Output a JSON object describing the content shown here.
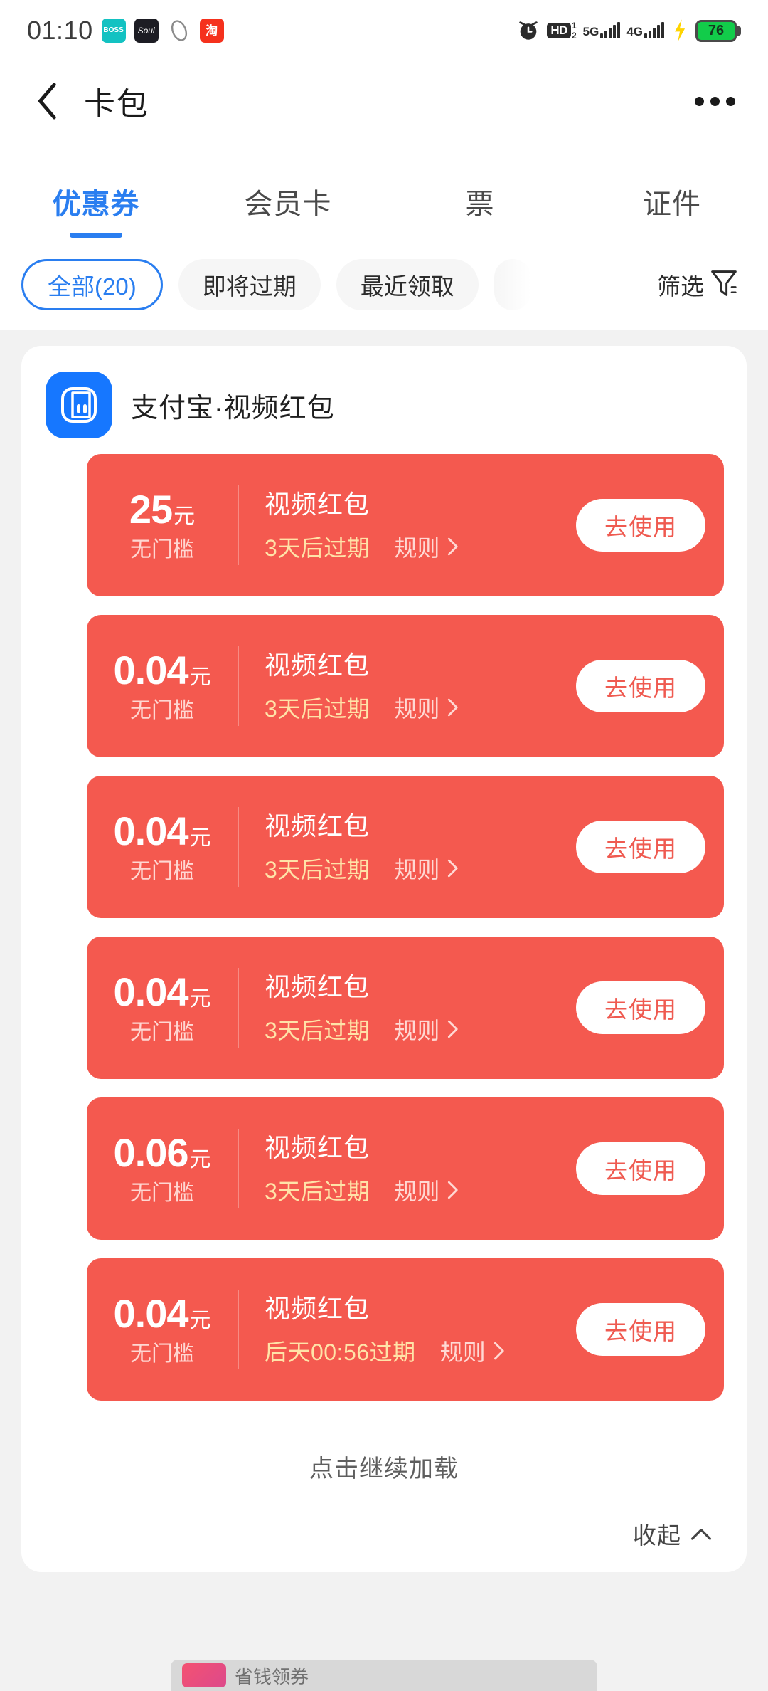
{
  "status_bar": {
    "time": "01:10",
    "app_icons": [
      {
        "name": "boss-zhipin-icon",
        "label": "BOSS"
      },
      {
        "name": "soul-icon",
        "label": "Soul"
      },
      {
        "name": "ring-icon",
        "label": ""
      },
      {
        "name": "taobao-icon",
        "label": "淘"
      }
    ],
    "alarm_icon": "alarm-clock-icon",
    "hd_label": "HD",
    "hd_sim1": "1",
    "hd_sim2": "2",
    "network_1": "5G",
    "network_2": "4G",
    "charging_icon": "charging-bolt-icon",
    "battery_level": "76"
  },
  "header": {
    "back_icon": "back-chevron-icon",
    "title": "卡包",
    "more_icon": "more-options-icon"
  },
  "tabs": [
    {
      "label": "优惠券",
      "active": true
    },
    {
      "label": "会员卡",
      "active": false
    },
    {
      "label": "票",
      "active": false
    },
    {
      "label": "证件",
      "active": false
    }
  ],
  "filters": {
    "chips": [
      {
        "label": "全部(20)",
        "selected": true
      },
      {
        "label": "即将过期",
        "selected": false
      },
      {
        "label": "最近领取",
        "selected": false
      }
    ],
    "filter_label": "筛选",
    "filter_icon": "funnel-filter-icon"
  },
  "merchant": {
    "logo_icon": "alipay-logo-icon",
    "name": "支付宝·视频红包"
  },
  "coupons": [
    {
      "amount": "25",
      "unit": "元",
      "condition": "无门槛",
      "title": "视频红包",
      "expire": "3天后过期",
      "rule": "规则",
      "button": "去使用"
    },
    {
      "amount": "0.04",
      "unit": "元",
      "condition": "无门槛",
      "title": "视频红包",
      "expire": "3天后过期",
      "rule": "规则",
      "button": "去使用"
    },
    {
      "amount": "0.04",
      "unit": "元",
      "condition": "无门槛",
      "title": "视频红包",
      "expire": "3天后过期",
      "rule": "规则",
      "button": "去使用"
    },
    {
      "amount": "0.04",
      "unit": "元",
      "condition": "无门槛",
      "title": "视频红包",
      "expire": "3天后过期",
      "rule": "规则",
      "button": "去使用"
    },
    {
      "amount": "0.06",
      "unit": "元",
      "condition": "无门槛",
      "title": "视频红包",
      "expire": "3天后过期",
      "rule": "规则",
      "button": "去使用"
    },
    {
      "amount": "0.04",
      "unit": "元",
      "condition": "无门槛",
      "title": "视频红包",
      "expire": "后天00:56过期",
      "rule": "规则",
      "button": "去使用"
    }
  ],
  "footer": {
    "load_more": "点击继续加载",
    "collapse": "收起",
    "collapse_icon": "chevron-up-icon"
  },
  "bottom_peek": {
    "text": "省钱领券"
  },
  "colors": {
    "accent_blue": "#2a7ef0",
    "coupon_red": "#f4594f",
    "button_text_red": "#ef5a50",
    "expire_yellow": "#ffe3a8",
    "page_bg": "#f2f2f2"
  }
}
